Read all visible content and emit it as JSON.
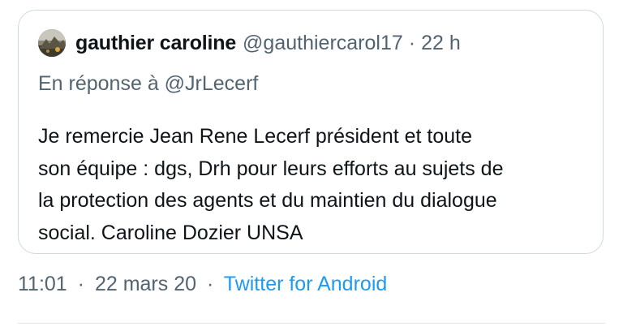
{
  "quoted_tweet": {
    "author": {
      "display_name": "gauthier caroline",
      "handle": "@gauthiercarol17",
      "avatar": "user-avatar-photo"
    },
    "separator": "·",
    "time_ago": "22 h",
    "reply_prefix": "En réponse à",
    "reply_to": "@JrLecerf",
    "text_lines": [
      "Je remercie Jean Rene Lecerf président et toute",
      "son équipe : dgs, Drh pour leurs efforts au sujets de",
      "la protection des agents et du maintien du dialogue",
      "social. Caroline Dozier UNSA"
    ]
  },
  "meta": {
    "time": "11:01",
    "separator": "·",
    "date": "22 mars 20",
    "separator2": "·",
    "source": "Twitter for Android"
  },
  "colors": {
    "text_primary": "#0f1419",
    "text_secondary": "#536471",
    "link": "#1d9bf0",
    "border": "#cfd9de"
  }
}
